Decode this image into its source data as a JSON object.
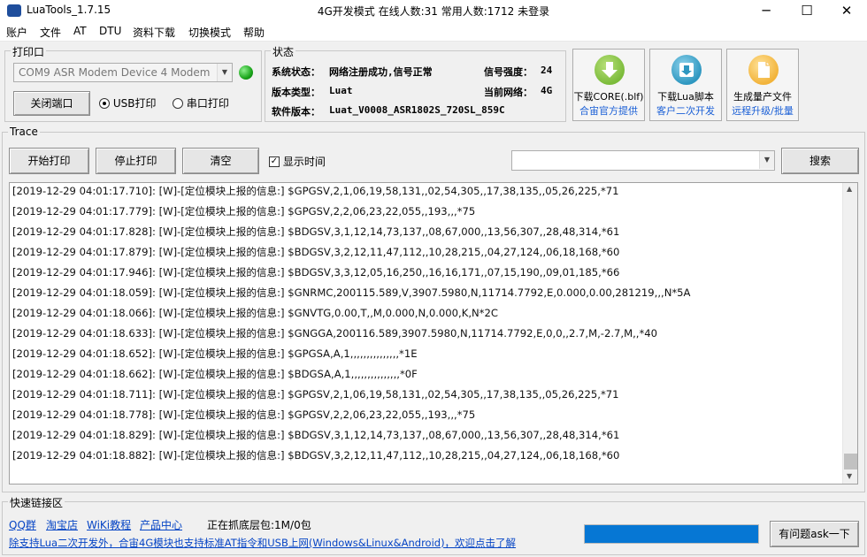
{
  "window": {
    "title": "LuaTools_1.7.15",
    "status_title": "4G开发模式  在线人数:31 常用人数:1712 未登录",
    "minimize": "─",
    "maximize": "☐",
    "close": "✕"
  },
  "menu": [
    "账户",
    "文件",
    "AT",
    "DTU",
    "资料下载",
    "切换模式",
    "帮助"
  ],
  "print_port": {
    "group_title": "打印口",
    "port_value": "COM9 ASR Modem Device 4 Modem",
    "close_port_label": "关闭端口",
    "usb_print_label": "USB打印",
    "serial_print_label": "串口打印",
    "selected_mode": "usb",
    "indicator_color": "#22b422"
  },
  "status": {
    "group_title": "状态",
    "sys_status_label": "系统状态：",
    "sys_status_value": "网络注册成功,信号正常",
    "signal_label": "信号强度：",
    "signal_value": "24",
    "version_type_label": "版本类型：",
    "version_type_value": "Luat",
    "network_label": "当前网络：",
    "network_value": "4G",
    "software_label": "软件版本：",
    "software_value": "Luat_V0008_ASR1802S_720SL_859C"
  },
  "tools": [
    {
      "line1": "下载CORE(.blf)",
      "line2": "合宙官方提供",
      "icon": "download-arrow-icon",
      "color": "#8ac44a"
    },
    {
      "line1": "下载Lua脚本",
      "line2": "客户二次开发",
      "icon": "download-box-icon",
      "color": "#37a2c8"
    },
    {
      "line1": "生成量产文件",
      "line2": "远程升级/批量",
      "icon": "document-icon",
      "color": "#f4b842"
    }
  ],
  "trace": {
    "group_title": "Trace",
    "start_label": "开始打印",
    "stop_label": "停止打印",
    "clear_label": "清空",
    "show_time_label": "显示时间",
    "show_time_checked": true,
    "search_value": "",
    "search_label": "搜索"
  },
  "log_lines": [
    "[2019-12-29 04:01:17.710]: [W]-[定位模块上报的信息:] $GPGSV,2,1,06,19,58,131,,02,54,305,,17,38,135,,05,26,225,*71",
    "[2019-12-29 04:01:17.779]: [W]-[定位模块上报的信息:] $GPGSV,2,2,06,23,22,055,,193,,,*75",
    "[2019-12-29 04:01:17.828]: [W]-[定位模块上报的信息:] $BDGSV,3,1,12,14,73,137,,08,67,000,,13,56,307,,28,48,314,*61",
    "[2019-12-29 04:01:17.879]: [W]-[定位模块上报的信息:] $BDGSV,3,2,12,11,47,112,,10,28,215,,04,27,124,,06,18,168,*60",
    "[2019-12-29 04:01:17.946]: [W]-[定位模块上报的信息:] $BDGSV,3,3,12,05,16,250,,16,16,171,,07,15,190,,09,01,185,*66",
    "[2019-12-29 04:01:18.059]: [W]-[定位模块上报的信息:] $GNRMC,200115.589,V,3907.5980,N,11714.7792,E,0.000,0.00,281219,,,N*5A",
    "[2019-12-29 04:01:18.066]: [W]-[定位模块上报的信息:] $GNVTG,0.00,T,,M,0.000,N,0.000,K,N*2C",
    "[2019-12-29 04:01:18.633]: [W]-[定位模块上报的信息:] $GNGGA,200116.589,3907.5980,N,11714.7792,E,0,0,,2.7,M,-2.7,M,,*40",
    "[2019-12-29 04:01:18.652]: [W]-[定位模块上报的信息:] $GPGSA,A,1,,,,,,,,,,,,,,,*1E",
    "[2019-12-29 04:01:18.662]: [W]-[定位模块上报的信息:] $BDGSA,A,1,,,,,,,,,,,,,,,*0F",
    "[2019-12-29 04:01:18.711]: [W]-[定位模块上报的信息:] $GPGSV,2,1,06,19,58,131,,02,54,305,,17,38,135,,05,26,225,*71",
    "[2019-12-29 04:01:18.778]: [W]-[定位模块上报的信息:] $GPGSV,2,2,06,23,22,055,,193,,,*75",
    "[2019-12-29 04:01:18.829]: [W]-[定位模块上报的信息:] $BDGSV,3,1,12,14,73,137,,08,67,000,,13,56,307,,28,48,314,*61",
    "[2019-12-29 04:01:18.882]: [W]-[定位模块上报的信息:] $BDGSV,3,2,12,11,47,112,,10,28,215,,04,27,124,,06,18,168,*60"
  ],
  "quick_links": {
    "group_title": "快速链接区",
    "qq_label": "QQ群",
    "taobao_label": "淘宝店",
    "wiki_label": "WiKi教程",
    "products_label": "产品中心",
    "capture_status": "正在抓底层包:1M/0包",
    "promo_text": "除支持Lua二次开发外，合宙4G模块也支持标准AT指令和USB上网(Windows&Linux&Android)，欢迎点击了解",
    "progress": 1.0,
    "progress_color": "#0677d4",
    "ask_label": "有问题ask一下"
  }
}
